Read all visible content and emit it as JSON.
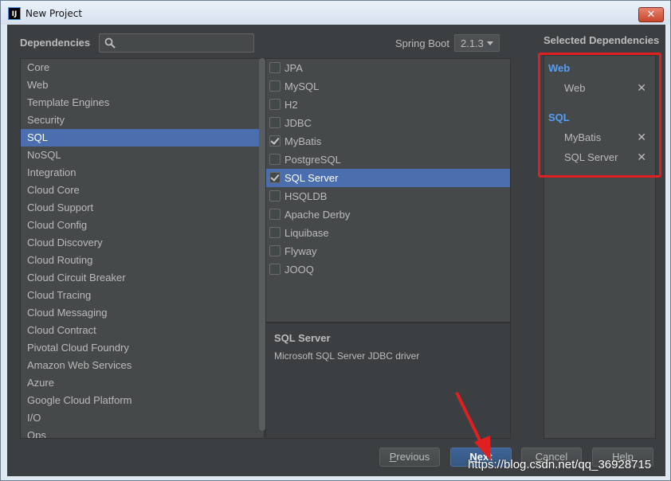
{
  "window": {
    "title": "New Project",
    "app_icon_text": "IJ"
  },
  "header": {
    "dependencies_label": "Dependencies",
    "search": {
      "value": "",
      "placeholder": ""
    },
    "spring_boot_label": "Spring Boot",
    "spring_boot_version": "2.1.3"
  },
  "categories": {
    "items": [
      "Core",
      "Web",
      "Template Engines",
      "Security",
      "SQL",
      "NoSQL",
      "Integration",
      "Cloud Core",
      "Cloud Support",
      "Cloud Config",
      "Cloud Discovery",
      "Cloud Routing",
      "Cloud Circuit Breaker",
      "Cloud Tracing",
      "Cloud Messaging",
      "Cloud Contract",
      "Pivotal Cloud Foundry",
      "Amazon Web Services",
      "Azure",
      "Google Cloud Platform",
      "I/O",
      "Ops"
    ],
    "selected": "SQL"
  },
  "dependencies": {
    "items": [
      {
        "label": "JPA",
        "checked": false
      },
      {
        "label": "MySQL",
        "checked": false
      },
      {
        "label": "H2",
        "checked": false
      },
      {
        "label": "JDBC",
        "checked": false
      },
      {
        "label": "MyBatis",
        "checked": true
      },
      {
        "label": "PostgreSQL",
        "checked": false
      },
      {
        "label": "SQL Server",
        "checked": true
      },
      {
        "label": "HSQLDB",
        "checked": false
      },
      {
        "label": "Apache Derby",
        "checked": false
      },
      {
        "label": "Liquibase",
        "checked": false
      },
      {
        "label": "Flyway",
        "checked": false
      },
      {
        "label": "JOOQ",
        "checked": false
      }
    ],
    "selected": "SQL Server"
  },
  "description": {
    "title": "SQL Server",
    "text": "Microsoft SQL Server JDBC driver"
  },
  "selected_dependencies": {
    "title": "Selected Dependencies",
    "groups": [
      {
        "name": "Web",
        "items": [
          "Web"
        ]
      },
      {
        "name": "SQL",
        "items": [
          "MyBatis",
          "SQL Server"
        ]
      }
    ],
    "remove_glyph": "✕"
  },
  "buttons": {
    "previous": {
      "mnemonic": "P",
      "rest": "revious"
    },
    "next": {
      "mnemonic": "N",
      "rest": "ext"
    },
    "cancel": {
      "mnemonic": "C",
      "rest": "ancel"
    },
    "help": {
      "mnemonic": "H",
      "rest": "elp"
    }
  },
  "watermark": "https://blog.csdn.net/qq_36928715",
  "colors": {
    "background": "#3c3f41",
    "list_background": "#45494a",
    "selection": "#4b6eaf",
    "group_label": "#589df6",
    "annotation_red": "#e02020"
  }
}
